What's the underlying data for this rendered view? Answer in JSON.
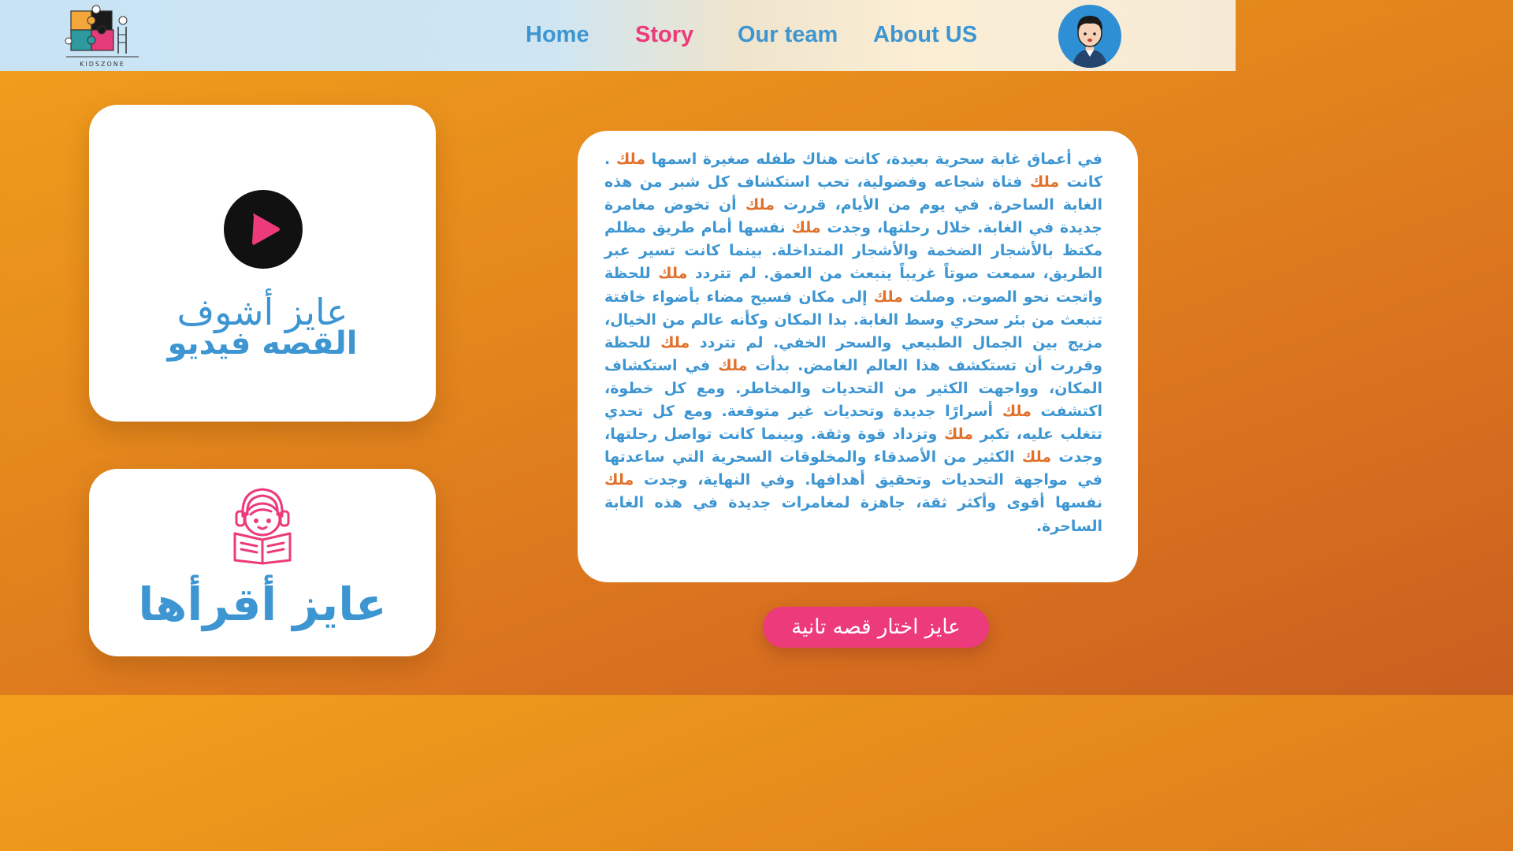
{
  "header": {
    "logo_text": "KIDSZONE",
    "nav": [
      {
        "label": "Home",
        "active": false
      },
      {
        "label": "Story",
        "active": true
      },
      {
        "label": "Our team",
        "active": false
      },
      {
        "label": "About US",
        "active": false
      }
    ],
    "avatar_icon": "boy-avatar-icon"
  },
  "video_card": {
    "icon": "play-icon",
    "line1": "عايز أشوف",
    "line2": "القصه فيديو"
  },
  "read_card": {
    "icon": "girl-reading-book-icon",
    "label": "عايز أقرأها"
  },
  "story": {
    "name": "ملك",
    "segments": [
      {
        "t": "في أعماق غابة سحرية بعيدة، كانت هناك طفله صغيرة اسمها "
      },
      {
        "t": "ملك",
        "name": true
      },
      {
        "t": " . كانت "
      },
      {
        "t": "ملك",
        "name": true
      },
      {
        "t": " فتاة شجاعه وفضولية، تحب استكشاف كل شبر من هذه الغابة الساحرة. في يوم من الأيام، قررت "
      },
      {
        "t": "ملك",
        "name": true
      },
      {
        "t": " أن تخوض مغامرة جديدة في الغابة. خلال رحلتها، وجدت "
      },
      {
        "t": "ملك",
        "name": true
      },
      {
        "t": " نفسها أمام طريق مظلم مكتظ بالأشجار الضخمة والأشجار المتداخلة. بينما كانت تسير عبر الطريق، سمعت صوتاً غريباً ينبعث من العمق. لم تتردد "
      },
      {
        "t": "ملك",
        "name": true
      },
      {
        "t": " للحظة واتجت نحو الصوت. وصلت "
      },
      {
        "t": "ملك",
        "name": true
      },
      {
        "t": " إلى مكان فسيح مضاء بأضواء خافتة تنبعث من بئر سحري وسط الغابة. بدا المكان وكأنه عالم من الخيال، مزيج بين الجمال الطبيعي والسحر الخفي. لم تتردد "
      },
      {
        "t": "ملك",
        "name": true
      },
      {
        "t": " للحظة وقررت أن تستكشف هذا العالم الغامض. بدأت "
      },
      {
        "t": "ملك",
        "name": true
      },
      {
        "t": " في استكشاف المكان، وواجهت الكثير من التحديات والمخاطر. ومع كل خطوة، اكتشفت "
      },
      {
        "t": "ملك",
        "name": true
      },
      {
        "t": " أسرارًا جديدة وتحديات غير متوقعة. ومع كل تحدي تتغلب عليه، تكبر "
      },
      {
        "t": "ملك",
        "name": true
      },
      {
        "t": " وتزداد قوة وثقة. وبينما كانت تواصل رحلتها، وجدت "
      },
      {
        "t": "ملك",
        "name": true
      },
      {
        "t": " الكثير من الأصدقاء والمخلوقات السحرية التي ساعدتها في مواجهة التحديات وتحقيق أهدافها. وفي النهاية، وجدت "
      },
      {
        "t": "ملك",
        "name": true
      },
      {
        "t": " نفسها أقوى وأكثر ثقة، جاهزة لمغامرات جديدة في هذه الغابة الساحرة."
      }
    ]
  },
  "choose_button": "عايز اختار قصه تانية",
  "colors": {
    "accent_blue": "#3d96d2",
    "accent_pink": "#ec3a7a",
    "name_orange": "#e0702a",
    "background_orange": "#e58a1c"
  }
}
